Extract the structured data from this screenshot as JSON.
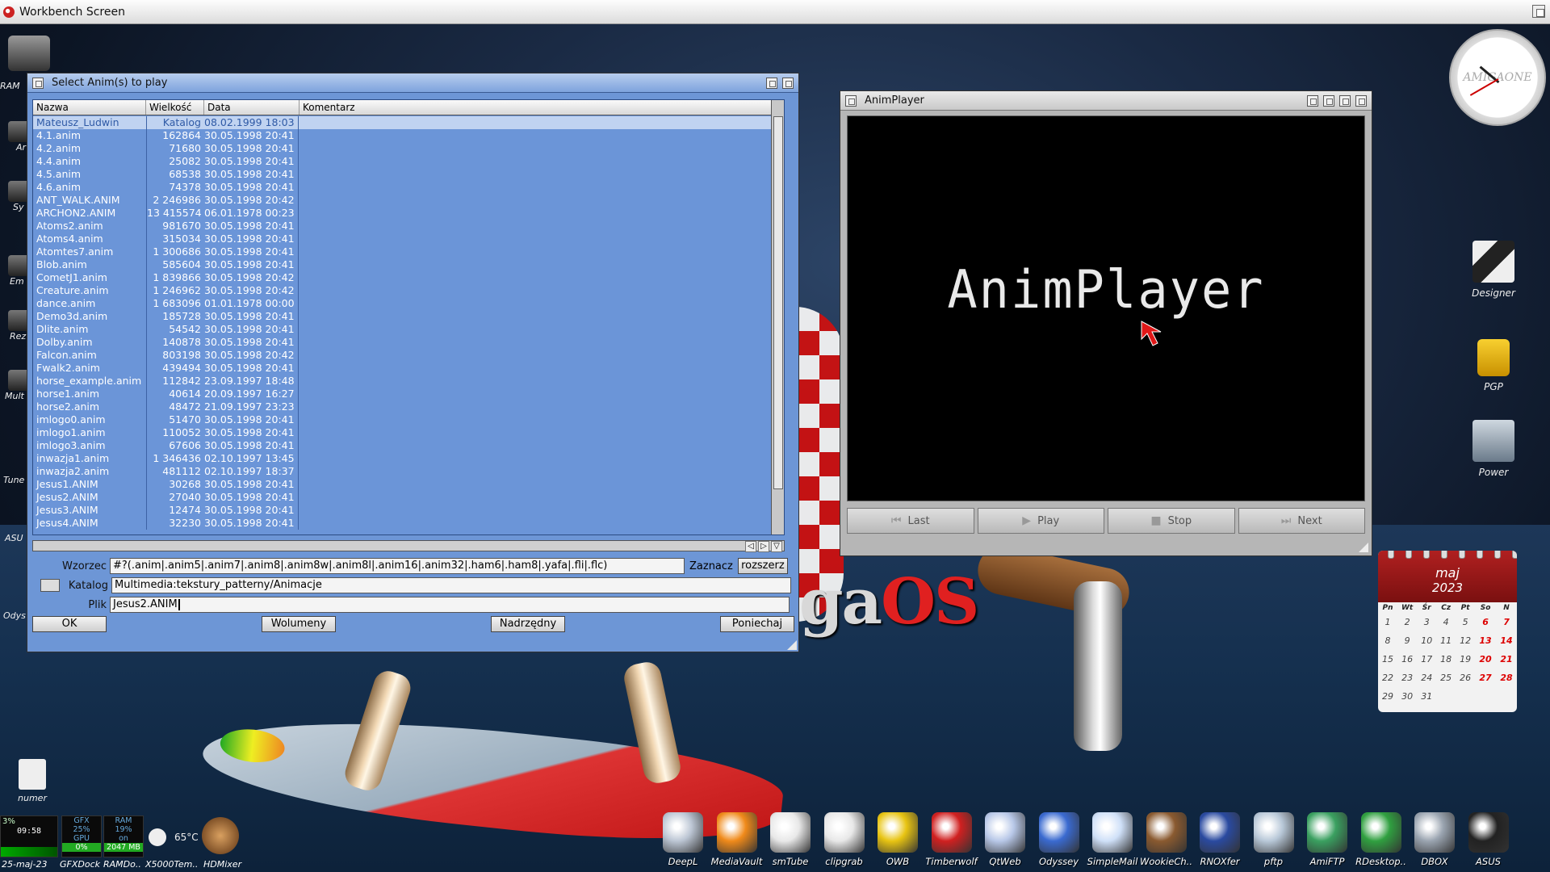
{
  "screen": {
    "title": "Workbench Screen"
  },
  "desktop_left": [
    {
      "label": "RAM"
    },
    {
      "label": "Ar"
    },
    {
      "label": "Sy"
    },
    {
      "label": "Em"
    },
    {
      "label": "Rez"
    },
    {
      "label": "Mult"
    },
    {
      "label": "Tune"
    },
    {
      "label": "ASU"
    },
    {
      "label": "Odys"
    }
  ],
  "requester": {
    "title": "Select Anim(s) to play",
    "columns": [
      "Nazwa",
      "Wielkość",
      "Data",
      "Komentarz"
    ],
    "rows": [
      {
        "name": "Mateusz_Ludwin",
        "size": "Katalog",
        "date": "08.02.1999 18:03",
        "dir": true
      },
      {
        "name": "4.1.anim",
        "size": "162864",
        "date": "30.05.1998 20:41"
      },
      {
        "name": "4.2.anim",
        "size": "71680",
        "date": "30.05.1998 20:41"
      },
      {
        "name": "4.4.anim",
        "size": "25082",
        "date": "30.05.1998 20:41"
      },
      {
        "name": "4.5.anim",
        "size": "68538",
        "date": "30.05.1998 20:41"
      },
      {
        "name": "4.6.anim",
        "size": "74378",
        "date": "30.05.1998 20:41"
      },
      {
        "name": "ANT_WALK.ANIM",
        "size": "2 246986",
        "date": "30.05.1998 20:42"
      },
      {
        "name": "ARCHON2.ANIM",
        "size": "13 415574",
        "date": "06.01.1978 00:23"
      },
      {
        "name": "Atoms2.anim",
        "size": "981670",
        "date": "30.05.1998 20:41"
      },
      {
        "name": "Atoms4.anim",
        "size": "315034",
        "date": "30.05.1998 20:41"
      },
      {
        "name": "Atomtes7.anim",
        "size": "1 300686",
        "date": "30.05.1998 20:41"
      },
      {
        "name": "Blob.anim",
        "size": "585604",
        "date": "30.05.1998 20:41"
      },
      {
        "name": "CometJ1.anim",
        "size": "1 839866",
        "date": "30.05.1998 20:42"
      },
      {
        "name": "Creature.anim",
        "size": "1 246962",
        "date": "30.05.1998 20:42"
      },
      {
        "name": "dance.anim",
        "size": "1 683096",
        "date": "01.01.1978 00:00"
      },
      {
        "name": "Demo3d.anim",
        "size": "185728",
        "date": "30.05.1998 20:41"
      },
      {
        "name": "Dlite.anim",
        "size": "54542",
        "date": "30.05.1998 20:41"
      },
      {
        "name": "Dolby.anim",
        "size": "140878",
        "date": "30.05.1998 20:41"
      },
      {
        "name": "Falcon.anim",
        "size": "803198",
        "date": "30.05.1998 20:42"
      },
      {
        "name": "Fwalk2.anim",
        "size": "439494",
        "date": "30.05.1998 20:41"
      },
      {
        "name": "horse_example.anim",
        "size": "112842",
        "date": "23.09.1997 18:48"
      },
      {
        "name": "horse1.anim",
        "size": "40614",
        "date": "20.09.1997 16:27"
      },
      {
        "name": "horse2.anim",
        "size": "48472",
        "date": "21.09.1997 23:23"
      },
      {
        "name": "imlogo0.anim",
        "size": "51470",
        "date": "30.05.1998 20:41"
      },
      {
        "name": "imlogo1.anim",
        "size": "110052",
        "date": "30.05.1998 20:41"
      },
      {
        "name": "imlogo3.anim",
        "size": "67606",
        "date": "30.05.1998 20:41"
      },
      {
        "name": "inwazja1.anim",
        "size": "1 346436",
        "date": "02.10.1997 13:45"
      },
      {
        "name": "inwazja2.anim",
        "size": "481112",
        "date": "02.10.1997 18:37"
      },
      {
        "name": "Jesus1.ANIM",
        "size": "30268",
        "date": "30.05.1998 20:41"
      },
      {
        "name": "Jesus2.ANIM",
        "size": "27040",
        "date": "30.05.1998 20:41"
      },
      {
        "name": "Jesus3.ANIM",
        "size": "12474",
        "date": "30.05.1998 20:41"
      },
      {
        "name": "Jesus4.ANIM",
        "size": "32230",
        "date": "30.05.1998 20:41"
      }
    ],
    "pattern_label": "Wzorzec",
    "pattern_value": "#?(.anim|.anim5|.anim7|.anim8|.anim8w|.anim8l|.anim16|.anim32|.ham6|.ham8|.yafa|.fli|.flc)",
    "select_label": "Zaznacz",
    "expand_button": "rozszerz",
    "drawer_label": "Katalog",
    "drawer_value": "Multimedia:tekstury_patterny/Animacje",
    "file_label": "Plik",
    "file_value": "Jesus2.ANIM",
    "buttons": {
      "ok": "OK",
      "volumes": "Wolumeny",
      "parent": "Nadrzędny",
      "cancel": "Poniechaj"
    }
  },
  "player": {
    "title": "AnimPlayer",
    "screen_text": "AnimPlayer",
    "buttons": {
      "last": "Last",
      "play": "Play",
      "stop": "Stop",
      "next": "Next"
    }
  },
  "desktop_right": {
    "clock_brand": "AMIGAONE",
    "icons": [
      {
        "label": "Designer"
      },
      {
        "label": "PGP"
      },
      {
        "label": "Power"
      }
    ]
  },
  "calendar": {
    "month": "maj",
    "year": "2023",
    "weekdays": [
      "Pn",
      "Wt",
      "Śr",
      "Cz",
      "Pt",
      "So",
      "N"
    ],
    "weeks": [
      [
        "1",
        "2",
        "3",
        "4",
        "5",
        "6",
        "7"
      ],
      [
        "8",
        "9",
        "10",
        "11",
        "12",
        "13",
        "14"
      ],
      [
        "15",
        "16",
        "17",
        "18",
        "19",
        "20",
        "21"
      ],
      [
        "22",
        "23",
        "24",
        "25",
        "26",
        "27",
        "28"
      ],
      [
        "29",
        "30",
        "31",
        "",
        "",
        "",
        ""
      ]
    ]
  },
  "logo": {
    "part1": "ga",
    "part2": "OS"
  },
  "left_widgets": {
    "numer_label": "numer",
    "percent": "3%",
    "time": "09:58",
    "date": "25-maj-23",
    "gfx": {
      "l1": "GFX",
      "l2": "25%",
      "l3": "GPU",
      "l4": "0%"
    },
    "gfxdock_label": "GFXDock",
    "ram": {
      "l1": "RAM",
      "l2": "19%",
      "l3": "on",
      "l4": "2047 MB"
    },
    "ramdock_label": "RAMDo..",
    "temp": "65°C",
    "x5000_label": "X5000Tem..",
    "hdmixer_label": "HDMixer"
  },
  "dock": [
    {
      "label": "DeepL",
      "color": "#bcc6d4"
    },
    {
      "label": "MediaVault",
      "color": "#f08a1a"
    },
    {
      "label": "smTube",
      "color": "#e8e8e8"
    },
    {
      "label": "clipgrab",
      "color": "#e8e8e8"
    },
    {
      "label": "OWB",
      "color": "#e8c412"
    },
    {
      "label": "Timberwolf",
      "color": "#d02020"
    },
    {
      "label": "QtWeb",
      "color": "#b8c8e8"
    },
    {
      "label": "Odyssey",
      "color": "#3a6ad0"
    },
    {
      "label": "SimpleMail",
      "color": "#cfe0f8"
    },
    {
      "label": "WookieCh..",
      "color": "#8a5a30"
    },
    {
      "label": "RNOXfer",
      "color": "#2a4aa0"
    },
    {
      "label": "pftp",
      "color": "#b8c8d8"
    },
    {
      "label": "AmiFTP",
      "color": "#3aa060"
    },
    {
      "label": "RDesktop..",
      "color": "#30a040"
    },
    {
      "label": "DBOX",
      "color": "#9aa4b0"
    },
    {
      "label": "ASUS",
      "color": "#222222"
    }
  ]
}
